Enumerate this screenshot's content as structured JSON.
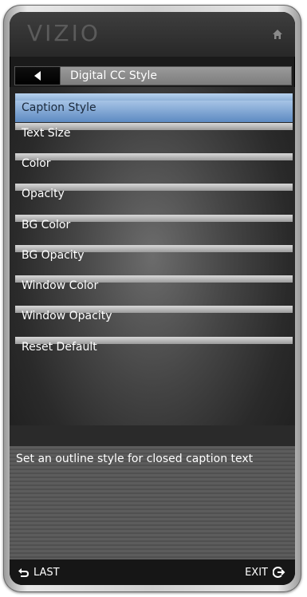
{
  "header": {
    "logo": "VIZIO",
    "home_icon": "home-icon"
  },
  "titlebar": {
    "back_icon": "back-arrow-icon",
    "title": "Digital CC Style"
  },
  "menu": {
    "items": [
      {
        "label": "Caption Style",
        "selected": true
      },
      {
        "label": "Text Size"
      },
      {
        "label": "Color"
      },
      {
        "label": "Opacity"
      },
      {
        "label": "BG Color"
      },
      {
        "label": "BG Opacity"
      },
      {
        "label": "Window Color"
      },
      {
        "label": "Window Opacity"
      },
      {
        "label": "Reset Default"
      }
    ]
  },
  "description": {
    "text": "Set an outline style for closed caption text"
  },
  "footer": {
    "last_label": "LAST",
    "last_icon": "return-arrow-icon",
    "exit_label": "EXIT",
    "exit_icon": "exit-icon"
  },
  "colors": {
    "selection": "#7fa6d3",
    "text": "#ffffff"
  }
}
